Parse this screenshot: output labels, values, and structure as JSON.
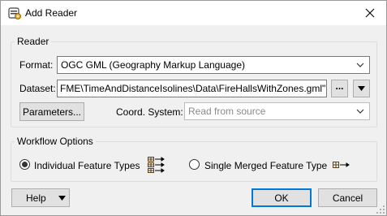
{
  "window": {
    "title": "Add Reader",
    "close_glyph": "✕"
  },
  "reader": {
    "group_label": "Reader",
    "format_label": "Format:",
    "format_value": "OGC GML (Geography Markup Language)",
    "dataset_label": "Dataset:",
    "dataset_value": "FME\\TimeAndDistanceIsolines\\Data\\FireHallsWithZones.gml\"",
    "browse_label": "...",
    "parameters_label": "Parameters...",
    "coord_label": "Coord. System:",
    "coord_placeholder": "Read from source"
  },
  "workflow": {
    "group_label": "Workflow Options",
    "option_individual": "Individual Feature Types",
    "option_merged": "Single Merged Feature Type",
    "selected": "individual"
  },
  "footer": {
    "help_label": "Help",
    "ok_label": "OK",
    "cancel_label": "Cancel"
  },
  "colors": {
    "accent": "#0078d7",
    "icon_orange": "#e8a317",
    "feature_icon": "#5a3e1b"
  }
}
